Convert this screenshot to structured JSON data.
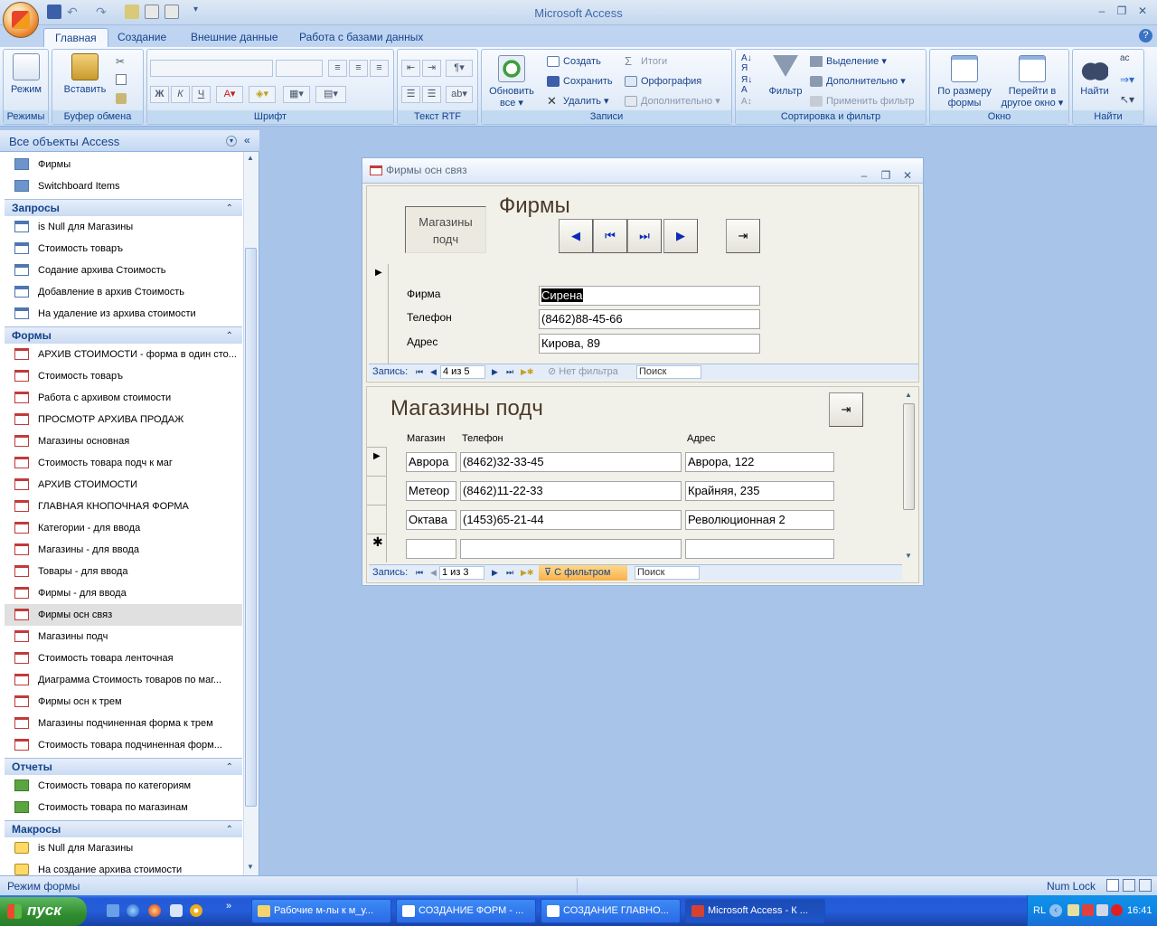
{
  "app": {
    "title": "Microsoft Access"
  },
  "tabs": [
    "Главная",
    "Создание",
    "Внешние данные",
    "Работа с базами данных"
  ],
  "ribbon": {
    "groups": {
      "views": "Режимы",
      "clipboard": "Буфер обмена",
      "font": "Шрифт",
      "rtf": "Текст RTF",
      "records": "Записи",
      "sort": "Сортировка и фильтр",
      "window": "Окно",
      "find": "Найти"
    },
    "mode_label": "Режим",
    "paste_label": "Вставить",
    "refresh_label1": "Обновить",
    "refresh_label2": "все ▾",
    "new_label": "Создать",
    "save_label": "Сохранить",
    "delete_label": "Удалить ▾",
    "totals_label": "Итоги",
    "spelling_label": "Орфография",
    "more_label": "Дополнительно ▾",
    "filter_label": "Фильтр",
    "selection_label": "Выделение ▾",
    "advanced_label": "Дополнительно ▾",
    "toggle_filter_label": "Применить фильтр",
    "fit_label1": "По размеру",
    "fit_label2": "формы",
    "switch_label1": "Перейти в",
    "switch_label2": "другое окно ▾",
    "find_label": "Найти",
    "font_bold": "Ж",
    "font_italic": "К",
    "font_underline": "Ч"
  },
  "nav": {
    "title": "Все объекты Access",
    "tables": [
      {
        "label": "Фирмы"
      },
      {
        "label": "Switchboard Items"
      }
    ],
    "queries_title": "Запросы",
    "queries": [
      {
        "label": "is Null для Магазины"
      },
      {
        "label": "Стоимость товаръ"
      },
      {
        "label": "Содание архива Стоимость"
      },
      {
        "label": "Добавление в архив Стоимость"
      },
      {
        "label": "На удаление из архива стоимости"
      }
    ],
    "forms_title": "Формы",
    "forms": [
      {
        "label": "АРХИВ СТОИМОСТИ - форма в один сто..."
      },
      {
        "label": "Стоимость товаръ"
      },
      {
        "label": "Работа с архивом стоимости"
      },
      {
        "label": "ПРОСМОТР АРХИВА ПРОДАЖ"
      },
      {
        "label": "Магазины основная"
      },
      {
        "label": "Стоимость товара подч к маг"
      },
      {
        "label": "АРХИВ СТОИМОСТИ"
      },
      {
        "label": "ГЛАВНАЯ КНОПОЧНАЯ ФОРМА"
      },
      {
        "label": "Категории - для ввода"
      },
      {
        "label": "Магазины - для ввода"
      },
      {
        "label": "Товары - для ввода"
      },
      {
        "label": "Фирмы - для ввода"
      },
      {
        "label": "Фирмы осн связ"
      },
      {
        "label": "Магазины подч"
      },
      {
        "label": "Стоимость товара ленточная"
      },
      {
        "label": "Диаграмма Стоимость товаров по  маг..."
      },
      {
        "label": "Фирмы осн к трем"
      },
      {
        "label": "Магазины подчиненная форма к трем"
      },
      {
        "label": "Стоимость товара подчиненная форм..."
      }
    ],
    "reports_title": "Отчеты",
    "reports": [
      {
        "label": "Стоимость товара по категориям"
      },
      {
        "label": "Стоимость товара по магазинам"
      }
    ],
    "macros_title": "Макросы",
    "macros": [
      {
        "label": "is Null для Магазины"
      },
      {
        "label": "На создание архива стоимости"
      }
    ]
  },
  "main_form": {
    "window_title": "Фирмы осн связ",
    "heading": "Фирмы",
    "subform_button": "Магазины подч",
    "fields": {
      "firm_label": "Фирма",
      "firm_value": "Сирена",
      "phone_label": "Телефон",
      "phone_value": "(8462)88-45-66",
      "address_label": "Адрес",
      "address_value": "Кирова, 89"
    },
    "record_bar": {
      "label": "Запись:",
      "position": "4 из 5",
      "filter": "Нет фильтра",
      "search": "Поиск"
    }
  },
  "sub_form": {
    "heading": "Магазины подч",
    "columns": [
      "Магазин",
      "Телефон",
      "Адрес"
    ],
    "rows": [
      {
        "shop": "Аврора",
        "phone": "(8462)32-33-45",
        "address": "Аврора, 122"
      },
      {
        "shop": "Метеор",
        "phone": "(8462)11-22-33",
        "address": "Крайняя, 235"
      },
      {
        "shop": "Октава",
        "phone": "(1453)65-21-44",
        "address": "Революционная 2"
      }
    ],
    "record_bar": {
      "label": "Запись:",
      "position": "1 из 3",
      "filter": "С фильтром",
      "search": "Поиск"
    }
  },
  "status": {
    "left": "Режим формы",
    "right": "Num Lock"
  },
  "taskbar": {
    "start": "пуск",
    "tasks": [
      {
        "label": "Рабочие м-лы к м_у..."
      },
      {
        "label": "СОЗДАНИЕ ФОРМ - ..."
      },
      {
        "label": "СОЗДАНИЕ ГЛАВНО..."
      },
      {
        "label": "Microsoft Access - К ..."
      }
    ],
    "lang": "RL",
    "clock": "16:41"
  }
}
